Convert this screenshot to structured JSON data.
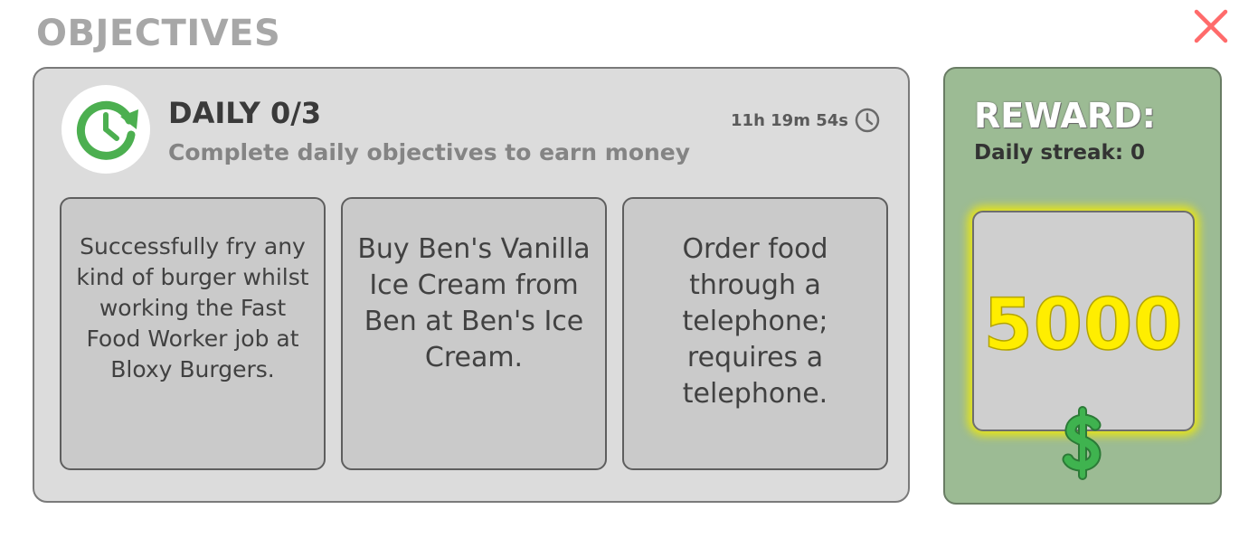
{
  "title": "OBJECTIVES",
  "daily": {
    "title": "DAILY 0/3",
    "subtitle": "Complete daily objectives to earn money",
    "timer": "11h 19m 54s"
  },
  "objectives": [
    {
      "text": "Successfully fry any kind of burger whilst working the Fast Food Worker job at Bloxy Burgers."
    },
    {
      "text": "Buy Ben's Vanilla Ice Cream from Ben at Ben's Ice Cream."
    },
    {
      "text": "Order food through a telephone; requires a telephone."
    }
  ],
  "reward": {
    "title": "REWARD:",
    "streak": "Daily streak: 0",
    "amount": "5000"
  },
  "icons": {
    "close": "close-icon",
    "daily": "clock-refresh-icon",
    "timer": "clock-icon",
    "currency": "dollar-icon"
  },
  "colors": {
    "close": "#ff6b6b",
    "daily_icon": "#4caf50",
    "reward_panel": "#9cbb94",
    "reward_amount": "#ffee00",
    "dollar": "#3fb34f"
  }
}
